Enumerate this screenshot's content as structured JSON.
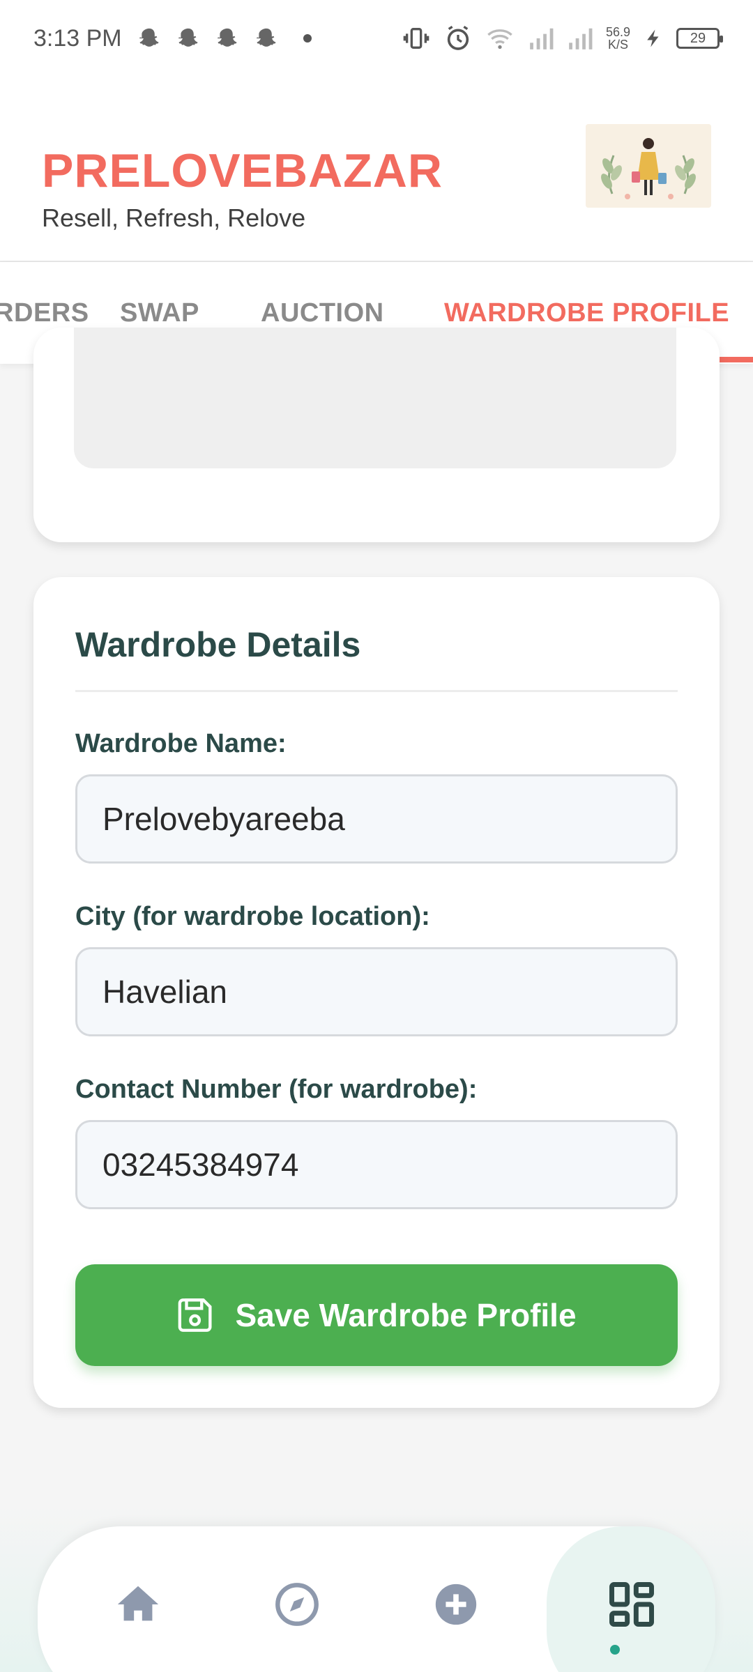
{
  "status_bar": {
    "time": "3:13 PM",
    "net_speed_value": "56.9",
    "net_speed_unit": "K/S",
    "battery_level": "29"
  },
  "header": {
    "title": "PRELOVEBAZAR",
    "tagline": "Resell, Refresh, Relove"
  },
  "tabs": [
    {
      "label": "ORDERS"
    },
    {
      "label": "SWAP"
    },
    {
      "label": "AUCTION"
    },
    {
      "label": "WARDROBE PROFILE",
      "active": true
    }
  ],
  "wardrobe_card": {
    "title": "Wardrobe Details",
    "name_label": "Wardrobe Name:",
    "name_value": "Prelovebyareeba",
    "city_label": "City (for wardrobe location):",
    "city_value": "Havelian",
    "contact_label": "Contact Number (for wardrobe):",
    "contact_value": "03245384974",
    "save_label": "Save Wardrobe Profile"
  },
  "bottom_nav": [
    {
      "icon": "home-icon"
    },
    {
      "icon": "compass-icon"
    },
    {
      "icon": "add-circle-icon"
    },
    {
      "icon": "qr-grid-icon",
      "active": true
    }
  ],
  "colors": {
    "brand": "#f26b5f",
    "heading": "#2b4a48",
    "save_button": "#4caf50",
    "nav_active_dot": "#26a38a"
  }
}
